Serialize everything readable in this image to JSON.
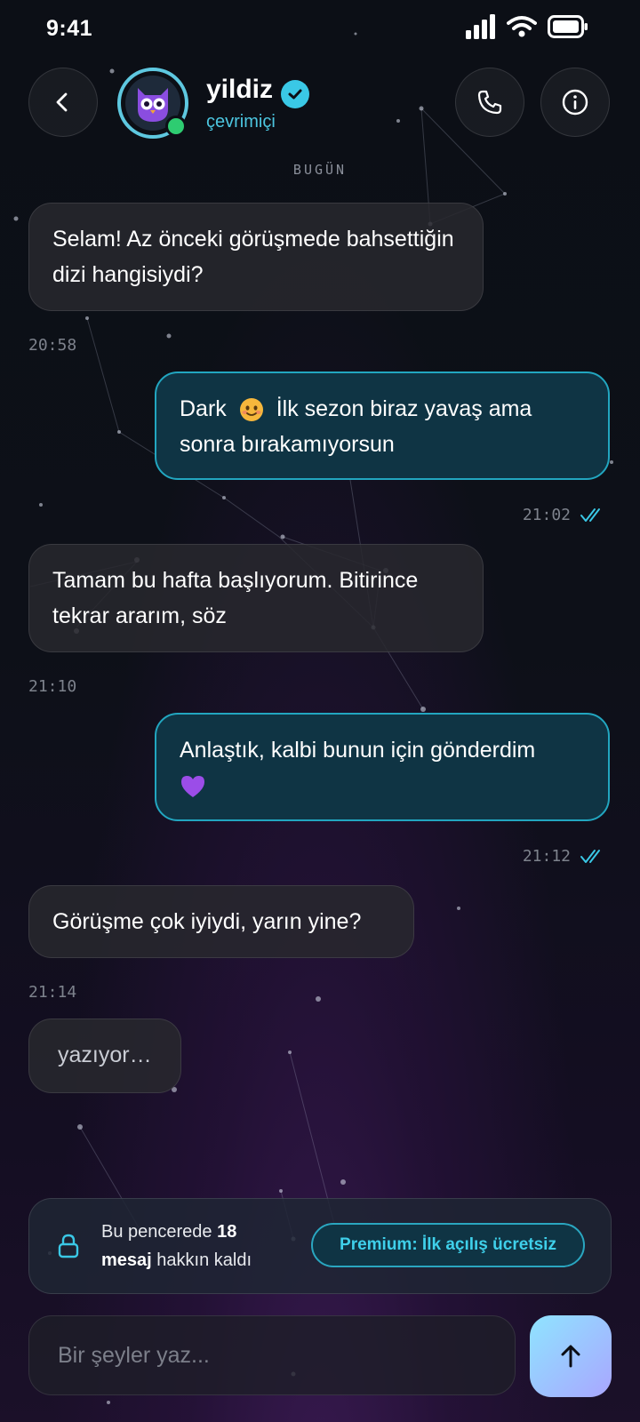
{
  "status_bar": {
    "time": "9:41"
  },
  "header": {
    "name": "yildiz",
    "status": "çevrimiçi",
    "back_icon": "chevron-left-icon",
    "call_icon": "phone-icon",
    "info_icon": "info-icon"
  },
  "date_separator": "BUGÜN",
  "messages": [
    {
      "dir": "in",
      "text": "Selam! Az önceki görüşmede bahsettiğin dizi hangisiydi?",
      "time": "20:58"
    },
    {
      "dir": "out",
      "text_before": "Dark",
      "emoji": "smiling-face-emoji",
      "text_after": "İlk sezon biraz yavaş ama sonra bırakamıyorsun",
      "time": "21:02",
      "read": true
    },
    {
      "dir": "in",
      "text": "Tamam bu hafta başlıyorum. Bitirince tekrar ararım, söz",
      "time": "21:10"
    },
    {
      "dir": "out",
      "text": "Anlaştık, kalbi bunun için gönderdim",
      "emoji": "purple-heart-emoji",
      "time": "21:12",
      "read": true
    },
    {
      "dir": "in",
      "text": "Görüşme çok iyiydi, yarın yine?",
      "time": "21:14"
    }
  ],
  "typing": "yazıyor…",
  "quota": {
    "prefix": "Bu pencerede",
    "count": "18",
    "unit": "mesaj",
    "suffix": "hakkın kaldı",
    "premium_label": "Premium: İlk açılış ücretsiz"
  },
  "composer": {
    "placeholder": "Bir şeyler yaz..."
  },
  "colors": {
    "accent": "#3ac8e6",
    "online": "#2ecc71",
    "outgoing_bubble": "#0f3444"
  }
}
